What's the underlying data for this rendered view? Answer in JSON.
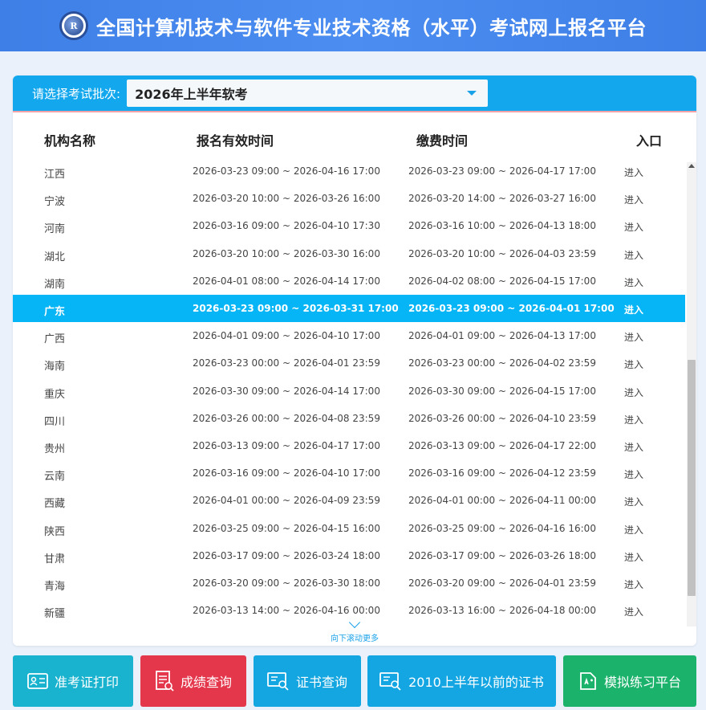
{
  "header": {
    "title": "全国计算机技术与软件专业技术资格（水平）考试网上报名平台",
    "logo_text": "R"
  },
  "batch": {
    "label": "请选择考试批次:",
    "selected": "2026年上半年软考"
  },
  "table": {
    "columns": [
      "机构名称",
      "报名有效时间",
      "缴费时间",
      "入口"
    ],
    "rows": [
      {
        "name": "江西",
        "reg": "2026-03-23 09:00 ~ 2026-04-16 17:00",
        "pay": "2026-03-23 09:00 ~ 2026-04-17 17:00",
        "entry": "进入"
      },
      {
        "name": "宁波",
        "reg": "2026-03-20 10:00 ~ 2026-03-26 16:00",
        "pay": "2026-03-20 14:00 ~ 2026-03-27 16:00",
        "entry": "进入"
      },
      {
        "name": "河南",
        "reg": "2026-03-16 09:00 ~ 2026-04-10 17:30",
        "pay": "2026-03-16 10:00 ~ 2026-04-13 18:00",
        "entry": "进入"
      },
      {
        "name": "湖北",
        "reg": "2026-03-20 10:00 ~ 2026-03-30 16:00",
        "pay": "2026-03-20 10:00 ~ 2026-04-03 23:59",
        "entry": "进入"
      },
      {
        "name": "湖南",
        "reg": "2026-04-01 08:00 ~ 2026-04-14 17:00",
        "pay": "2026-04-02 08:00 ~ 2026-04-15 17:00",
        "entry": "进入"
      },
      {
        "name": "广东",
        "reg": "2026-03-23 09:00 ~ 2026-03-31 17:00",
        "pay": "2026-03-23 09:00 ~ 2026-04-01 17:00",
        "entry": "进入",
        "highlighted": true
      },
      {
        "name": "广西",
        "reg": "2026-04-01 09:00 ~ 2026-04-10 17:00",
        "pay": "2026-04-01 09:00 ~ 2026-04-13 17:00",
        "entry": "进入"
      },
      {
        "name": "海南",
        "reg": "2026-03-23 00:00 ~ 2026-04-01 23:59",
        "pay": "2026-03-23 00:00 ~ 2026-04-02 23:59",
        "entry": "进入"
      },
      {
        "name": "重庆",
        "reg": "2026-03-30 09:00 ~ 2026-04-14 17:00",
        "pay": "2026-03-30 09:00 ~ 2026-04-15 17:00",
        "entry": "进入"
      },
      {
        "name": "四川",
        "reg": "2026-03-26 00:00 ~ 2026-04-08 23:59",
        "pay": "2026-03-26 00:00 ~ 2026-04-10 23:59",
        "entry": "进入"
      },
      {
        "name": "贵州",
        "reg": "2026-03-13 09:00 ~ 2026-04-17 17:00",
        "pay": "2026-03-13 09:00 ~ 2026-04-17 22:00",
        "entry": "进入"
      },
      {
        "name": "云南",
        "reg": "2026-03-16 09:00 ~ 2026-04-10 17:00",
        "pay": "2026-03-16 09:00 ~ 2026-04-12 23:59",
        "entry": "进入"
      },
      {
        "name": "西藏",
        "reg": "2026-04-01 00:00 ~ 2026-04-09 23:59",
        "pay": "2026-04-01 00:00 ~ 2026-04-11 00:00",
        "entry": "进入"
      },
      {
        "name": "陕西",
        "reg": "2026-03-25 09:00 ~ 2026-04-15 16:00",
        "pay": "2026-03-25 09:00 ~ 2026-04-16 16:00",
        "entry": "进入"
      },
      {
        "name": "甘肃",
        "reg": "2026-03-17 09:00 ~ 2026-03-24 18:00",
        "pay": "2026-03-17 09:00 ~ 2026-03-26 18:00",
        "entry": "进入"
      },
      {
        "name": "青海",
        "reg": "2026-03-20 09:00 ~ 2026-03-30 18:00",
        "pay": "2026-03-20 09:00 ~ 2026-04-01 23:59",
        "entry": "进入"
      },
      {
        "name": "新疆",
        "reg": "2026-03-13 14:00 ~ 2026-04-16 00:00",
        "pay": "2026-03-13 16:00 ~ 2026-04-18 00:00",
        "entry": "进入"
      }
    ]
  },
  "scroll_hint": "向下滚动更多",
  "buttons": [
    {
      "label": "准考证打印",
      "icon": "id-card-icon"
    },
    {
      "label": "成绩查询",
      "icon": "score-doc-icon"
    },
    {
      "label": "证书查询",
      "icon": "certificate-icon"
    },
    {
      "label": "2010上半年以前的证书",
      "icon": "certificate-icon"
    },
    {
      "label": "模拟练习平台",
      "icon": "practice-edit-icon"
    }
  ]
}
